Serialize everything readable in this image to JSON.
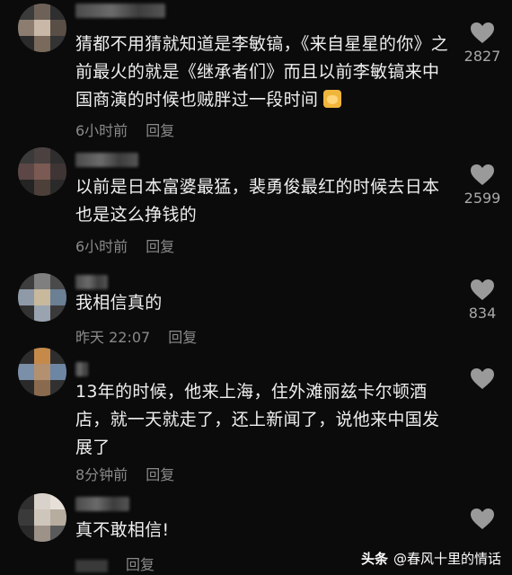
{
  "comments": [
    {
      "username": "",
      "text": "猜都不用猜就知道是李敏镐，《来自星星的你》之前最火的就是《继承者们》而且以前李敏镐来中国商演的时候也贼胖过一段时间",
      "time": "6小时前",
      "reply": "回复",
      "likes": "2827"
    },
    {
      "username": "",
      "text": "以前是日本富婆最猛，裴勇俊最红的时候去日本也是这么挣钱的",
      "time": "6小时前",
      "reply": "回复",
      "likes": "2599"
    },
    {
      "username": "",
      "text": "我相信真的",
      "time": "昨天 22:07",
      "reply": "回复",
      "likes": "834"
    },
    {
      "username": "",
      "text": "13年的时候，他来上海，住外滩丽兹卡尔顿酒店，就一天就走了，还上新闻了，说他来中国发展了",
      "time": "8分钟前",
      "reply": "回复",
      "likes": ""
    },
    {
      "username": "",
      "text": "真不敢相信!",
      "time": "",
      "reply": "回复",
      "likes": ""
    }
  ],
  "watermark": {
    "brand": "头条",
    "account": "@春风十里的情话"
  },
  "colors": {
    "background": "#0b0b0b",
    "text": "#efefef",
    "meta": "#8a8a8a",
    "heart": "#9a9a9a"
  },
  "icons": [
    "heart-icon",
    "cat-emoji-icon"
  ]
}
